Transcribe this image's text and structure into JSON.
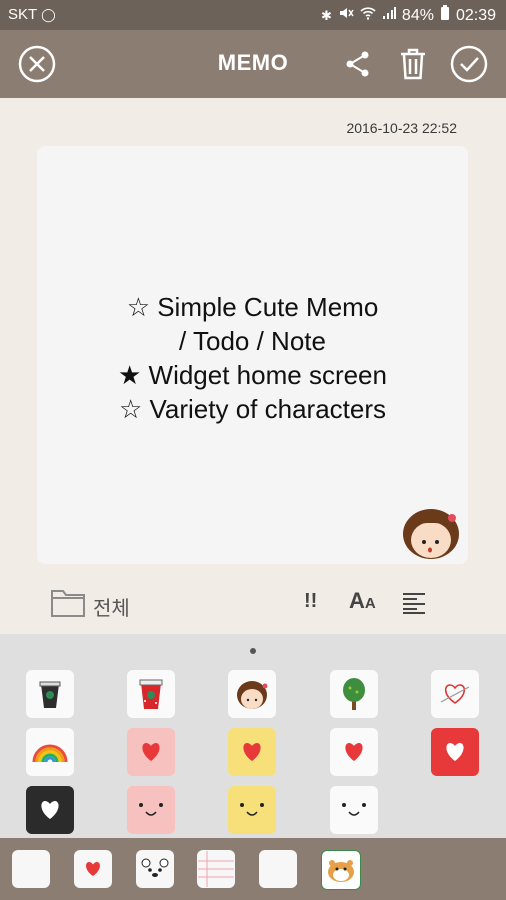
{
  "status": {
    "carrier": "SKT",
    "battery": "84%",
    "time": "02:39"
  },
  "appbar": {
    "title": "MEMO"
  },
  "memo": {
    "date": "2016-10-23 22:52",
    "lines": [
      "☆ Simple Cute Memo",
      "/ Todo / Note",
      "★ Widget home screen",
      "☆ Variety of characters"
    ]
  },
  "toolbar": {
    "folder_label": "전체",
    "important_label": "!!",
    "font_label_big": "A",
    "font_label_small": "A"
  },
  "colors": {
    "statusbar": "#6d625a",
    "appbar": "#8c7d72",
    "background": "#f1ece5",
    "heart": "#e8393a"
  },
  "stickers": [
    "coffee-cup-icon",
    "red-cup-icon",
    "girl-face-icon",
    "tree-icon",
    "heart-arrow-icon",
    "rainbow-icon",
    "heart-on-pink-icon",
    "heart-on-yellow-icon",
    "heart-on-white-icon",
    "heart-on-red-icon",
    "heart-on-black-icon",
    "smile-pink-icon",
    "smile-yellow-icon",
    "smile-white-icon"
  ],
  "bottom_tabs": [
    "plain-paper-icon",
    "heart-paper-icon",
    "bear-paper-icon",
    "lined-paper-icon",
    "speech-bubble-icon",
    "hamster-paper-icon"
  ]
}
